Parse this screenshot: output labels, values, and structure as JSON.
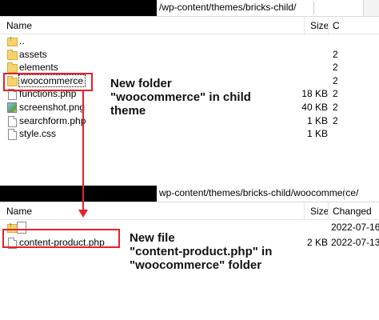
{
  "top_panel": {
    "path": "/wp-content/themes/bricks-child/",
    "columns": {
      "name": "Name",
      "size": "Size",
      "extra": "C"
    },
    "rows": [
      {
        "icon": "parent-folder-icon",
        "name": "..",
        "size": ""
      },
      {
        "icon": "folder-icon",
        "name": "assets",
        "size": ""
      },
      {
        "icon": "folder-icon",
        "name": "elements",
        "size": ""
      },
      {
        "icon": "folder-icon",
        "name": "woocommerce",
        "size": ""
      },
      {
        "icon": "php-file-icon",
        "name": "functions.php",
        "size": "18 KB"
      },
      {
        "icon": "image-file-icon",
        "name": "screenshot.png",
        "size": "40 KB"
      },
      {
        "icon": "php-file-icon",
        "name": "searchform.php",
        "size": "1 KB"
      },
      {
        "icon": "css-file-icon",
        "name": "style.css",
        "size": "1 KB"
      }
    ],
    "right_column_marks": [
      "2",
      "2",
      "2",
      "2",
      "2",
      "2"
    ]
  },
  "bottom_panel": {
    "path": "wp-content/themes/bricks-child/woocommerce/",
    "columns": {
      "name": "Name",
      "size": "Size",
      "changed": "Changed"
    },
    "rows": [
      {
        "icon": "parent-folder-icon",
        "name": "",
        "size": "",
        "changed": "2022-07-16"
      },
      {
        "icon": "php-file-icon",
        "name": "content-product.php",
        "size": "2 KB",
        "changed": "2022-07-13"
      }
    ]
  },
  "annotations": {
    "folder_note": "New folder\n\"woocommerce\" in child\ntheme",
    "file_note": "New file\n\"content-product.php\" in\n\"woocommerce\" folder"
  },
  "colors": {
    "highlight_red": "#e8202a",
    "folder_yellow": "#f6d36b"
  }
}
